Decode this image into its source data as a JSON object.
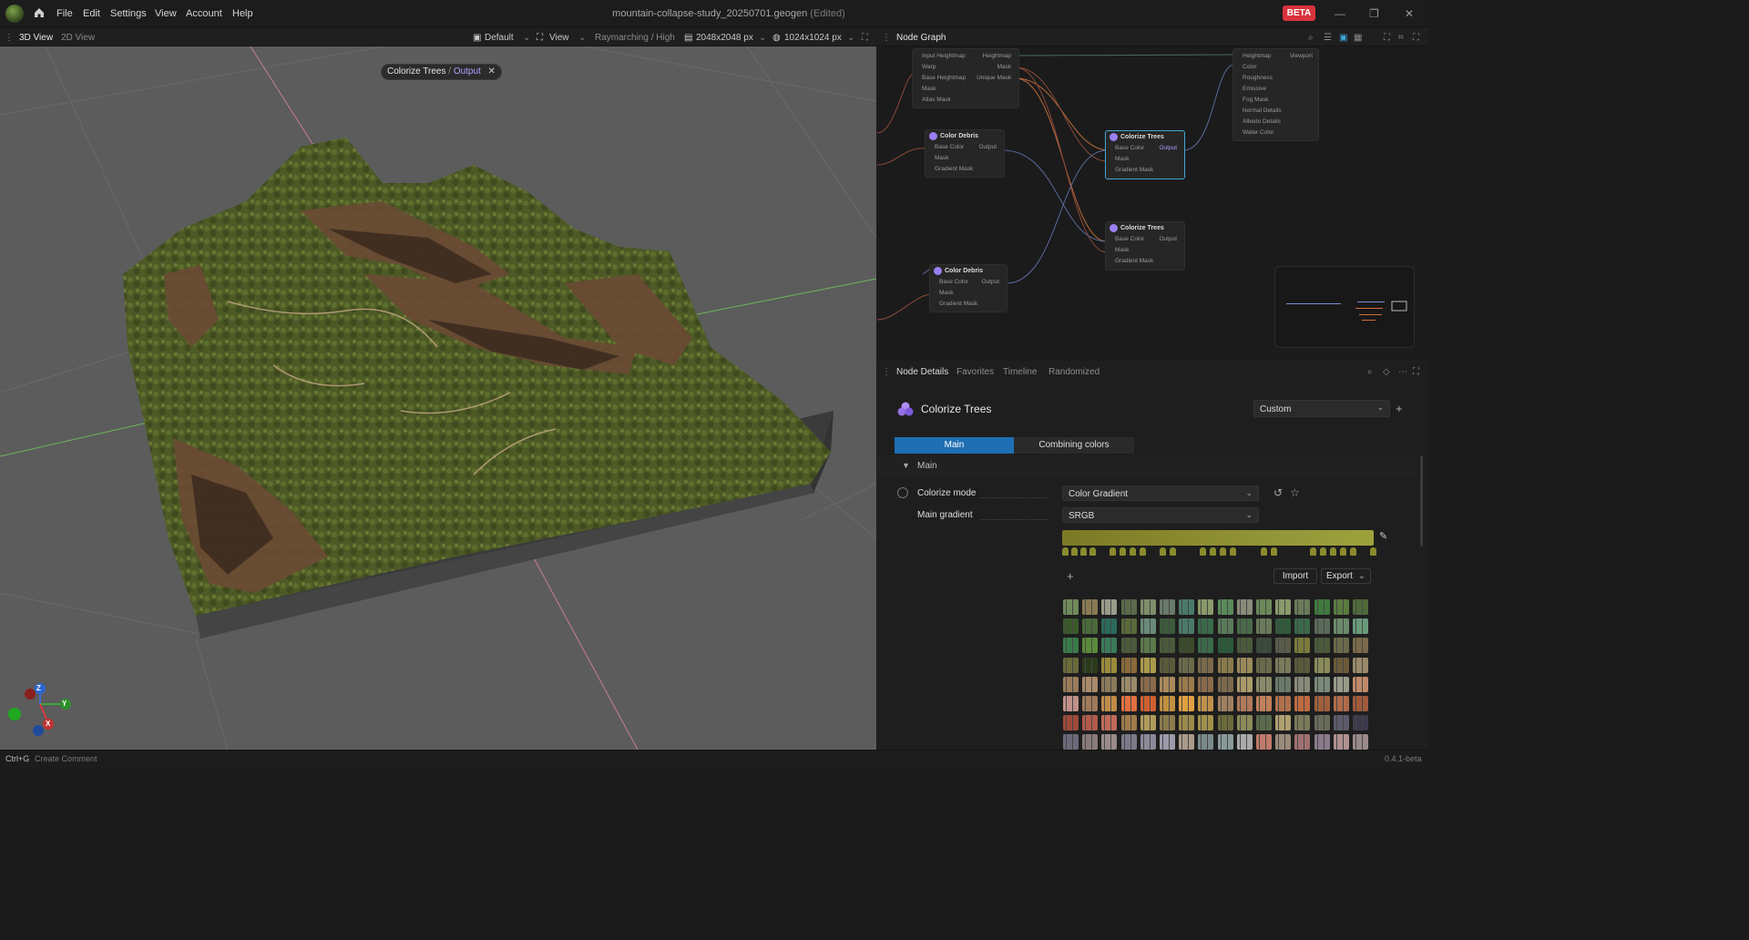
{
  "menu": {
    "file": "File",
    "edit": "Edit",
    "settings": "Settings",
    "view": "View",
    "account": "Account",
    "help": "Help"
  },
  "window": {
    "title": "mountain-collapse-study_20250701.geogen",
    "edited": "(Edited)",
    "beta": "BETA"
  },
  "viewport_toolbar": {
    "tab_3d": "3D View",
    "tab_2d": "2D View",
    "preset": "Default",
    "view": "View",
    "render_mode": "Raymarching / High",
    "resolution": "2048x2048 px",
    "output_res": "1024x1024 px"
  },
  "viewport": {
    "chip_node": "Colorize Trees",
    "chip_sep": "/",
    "chip_port": "Output",
    "axes": {
      "z": "Z",
      "y": "Y",
      "x": "X"
    }
  },
  "graph": {
    "title": "Node Graph",
    "node_terrain": {
      "left": [
        "Input Heightmap",
        "Warp",
        "Base Heightmap",
        "Mask",
        "Atlas Mask"
      ],
      "right": [
        "Heightmap",
        "Mask",
        "Unique Mask"
      ]
    },
    "node_output": {
      "ports": [
        "Heightmap",
        "Color",
        "Roughness",
        "Emissive",
        "Fog Mask",
        "Normal Details",
        "Albedo Details",
        "Water Color"
      ],
      "right": "Viewport"
    },
    "node_debris1": {
      "title": "Color Debris",
      "ports": [
        "Base Color",
        "Mask",
        "Gradient Mask"
      ],
      "out": "Output"
    },
    "node_trees1": {
      "title": "Colorize Trees",
      "ports": [
        "Base Color",
        "Mask",
        "Gradient Mask"
      ],
      "out": "Output"
    },
    "node_trees2": {
      "title": "Colorize Trees",
      "ports": [
        "Base Color",
        "Mask",
        "Gradient Mask"
      ],
      "out": "Output"
    },
    "node_debris2": {
      "title": "Color Debris",
      "ports": [
        "Base Color",
        "Mask",
        "Gradient Mask"
      ],
      "out": "Output"
    }
  },
  "details": {
    "tabs": [
      "Node Details",
      "Favorites",
      "Timeline",
      "Randomized"
    ],
    "node_name": "Colorize Trees",
    "preset": "Custom",
    "subtabs": [
      "Main",
      "Combining colors"
    ],
    "section": "Main",
    "colorize_mode_label": "Colorize mode",
    "colorize_mode_value": "Color Gradient",
    "main_gradient_label": "Main gradient",
    "main_gradient_space": "SRGB",
    "import": "Import",
    "export": "Export",
    "add": "+"
  },
  "statusbar": {
    "shortcut": "Ctrl+G",
    "hint": "Create Comment",
    "version": "0.4.1-beta"
  },
  "colors": {
    "accent": "#1e6fb3",
    "node_selected": "#3fa7d6",
    "port_highlight": "#b79cff",
    "beta": "#d8333d",
    "gradient_start": "#7a7a26",
    "gradient_end": "#9ea23a"
  }
}
